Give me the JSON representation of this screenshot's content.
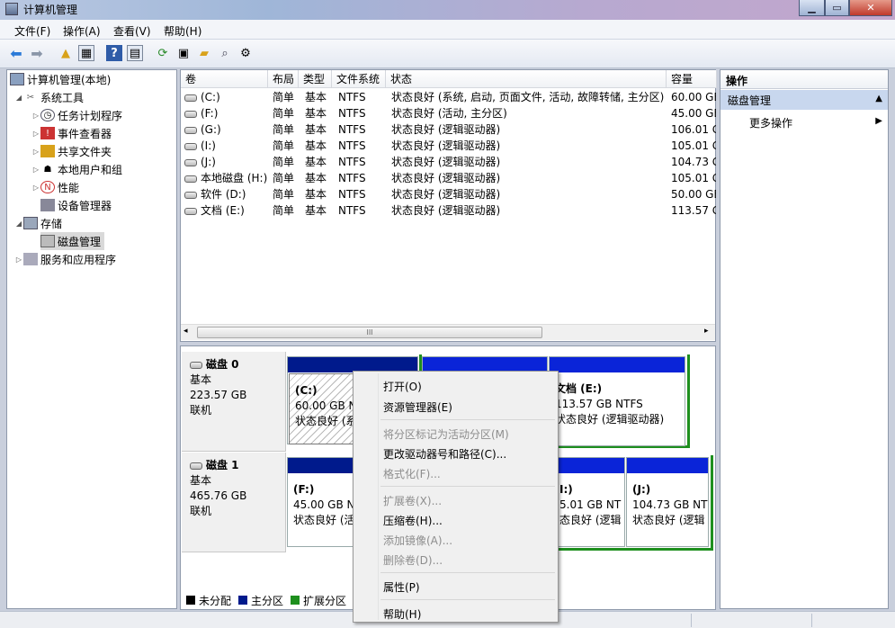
{
  "window": {
    "title": "计算机管理"
  },
  "menubar": {
    "items": [
      "文件(F)",
      "操作(A)",
      "查看(V)",
      "帮助(H)"
    ]
  },
  "toolbar": {
    "icons": [
      "back-arrow-icon",
      "forward-arrow-icon",
      "up-folder-icon",
      "show-hide-tree-icon",
      "help-icon",
      "console-tree-icon",
      "refresh-icon",
      "properties-icon",
      "open-folder-icon",
      "search-icon",
      "disk-settings-icon"
    ]
  },
  "tree": {
    "items": [
      "计算机管理(本地)",
      "系统工具",
      "任务计划程序",
      "事件查看器",
      "共享文件夹",
      "本地用户和组",
      "性能",
      "设备管理器",
      "存储",
      "磁盘管理",
      "服务和应用程序"
    ]
  },
  "volumes": {
    "columns": [
      "卷",
      "布局",
      "类型",
      "文件系统",
      "状态",
      "容量"
    ],
    "rows": [
      [
        "(C:)",
        "简单",
        "基本",
        "NTFS",
        "状态良好 (系统, 启动, 页面文件, 活动, 故障转储, 主分区)",
        "60.00 GB"
      ],
      [
        "(F:)",
        "简单",
        "基本",
        "NTFS",
        "状态良好 (活动, 主分区)",
        "45.00 GB"
      ],
      [
        "(G:)",
        "简单",
        "基本",
        "NTFS",
        "状态良好 (逻辑驱动器)",
        "106.01 G"
      ],
      [
        "(I:)",
        "简单",
        "基本",
        "NTFS",
        "状态良好 (逻辑驱动器)",
        "105.01 G"
      ],
      [
        "(J:)",
        "简单",
        "基本",
        "NTFS",
        "状态良好 (逻辑驱动器)",
        "104.73 G"
      ],
      [
        "本地磁盘 (H:)",
        "简单",
        "基本",
        "NTFS",
        "状态良好 (逻辑驱动器)",
        "105.01 G"
      ],
      [
        "软件 (D:)",
        "简单",
        "基本",
        "NTFS",
        "状态良好 (逻辑驱动器)",
        "50.00 GB"
      ],
      [
        "文档 (E:)",
        "简单",
        "基本",
        "NTFS",
        "状态良好 (逻辑驱动器)",
        "113.57 G"
      ]
    ],
    "scroll_glyph": "III"
  },
  "disks": [
    {
      "name": "磁盘 0",
      "type": "基本",
      "size": "223.57 GB",
      "state": "联机",
      "parts": [
        {
          "title": "(C:)",
          "size": "60.00 GB N",
          "status": "状态良好 (系"
        },
        {
          "title": "",
          "size": "",
          "status": ""
        },
        {
          "title": "文档 (E:)",
          "size": "113.57 GB NTFS",
          "status": "状态良好 (逻辑驱动器)"
        }
      ]
    },
    {
      "name": "磁盘 1",
      "type": "基本",
      "size": "465.76 GB",
      "state": "联机",
      "parts": [
        {
          "title": "(F:)",
          "size": "45.00 GB N",
          "status": "状态良好 (活"
        },
        {
          "title": "I:)",
          "size": "5.01 GB NT",
          "status": "态良好 (逻辑"
        },
        {
          "title": "(J:)",
          "size": "104.73 GB NT",
          "status": "状态良好 (逻辑"
        }
      ]
    }
  ],
  "legend": {
    "items": [
      "未分配",
      "主分区",
      "扩展分区"
    ],
    "colors": [
      "#000000",
      "#001a8c",
      "#1e8f1e"
    ]
  },
  "actions": {
    "header": "操作",
    "section": "磁盘管理",
    "more": "更多操作"
  },
  "context_menu": {
    "items": [
      {
        "label": "打开(O)",
        "enabled": true
      },
      {
        "label": "资源管理器(E)",
        "enabled": true
      },
      {
        "label": "将分区标记为活动分区(M)",
        "enabled": false
      },
      {
        "label": "更改驱动器号和路径(C)...",
        "enabled": true
      },
      {
        "label": "格式化(F)...",
        "enabled": false
      },
      {
        "label": "扩展卷(X)...",
        "enabled": false
      },
      {
        "label": "压缩卷(H)...",
        "enabled": true
      },
      {
        "label": "添加镜像(A)...",
        "enabled": false
      },
      {
        "label": "删除卷(D)...",
        "enabled": false
      },
      {
        "label": "属性(P)",
        "enabled": true
      },
      {
        "label": "帮助(H)",
        "enabled": true
      }
    ]
  },
  "colors": {
    "primary_partition": "#001a8c",
    "extended_partition": "#1e8f1e",
    "selected_section": "#c8d7ee"
  }
}
